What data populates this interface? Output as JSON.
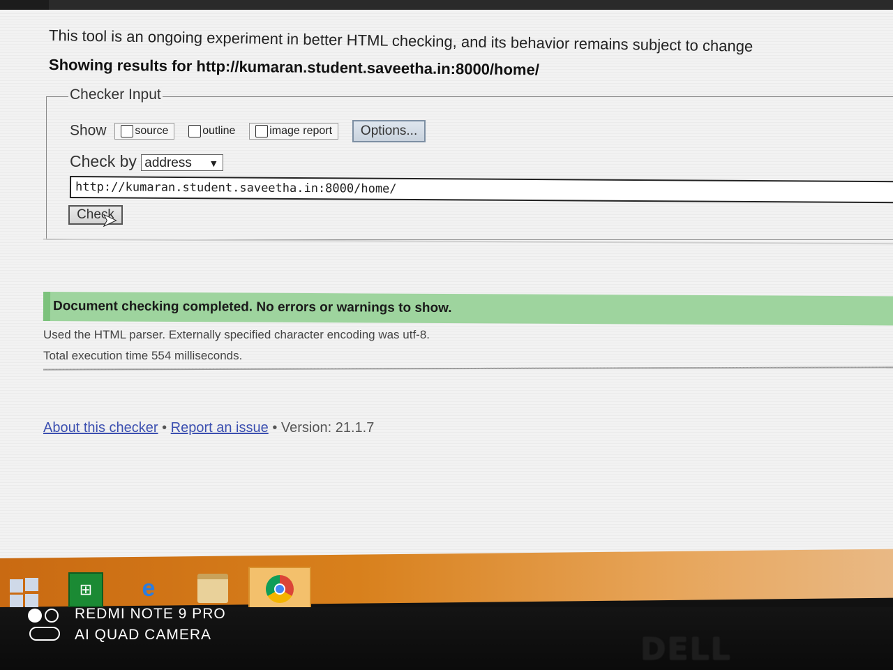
{
  "intro_text": "This tool is an ongoing experiment in better HTML checking, and its behavior remains subject to change",
  "showing_results": "Showing results for http://kumaran.student.saveetha.in:8000/home/",
  "checker_input": {
    "legend": "Checker Input",
    "show_label": "Show",
    "checkboxes": [
      {
        "label": "source",
        "checked": false
      },
      {
        "label": "outline",
        "checked": false
      },
      {
        "label": "image report",
        "checked": false
      }
    ],
    "options_button": "Options...",
    "check_by_label": "Check by",
    "check_by_value": "address",
    "url_value": "http://kumaran.student.saveetha.in:8000/home/",
    "check_button": "Check"
  },
  "result": {
    "success_message": "Document checking completed. No errors or warnings to show.",
    "parser_info": "Used the HTML parser. Externally specified character encoding was utf-8.",
    "execution_time": "Total execution time 554 milliseconds."
  },
  "footer": {
    "about_link": "About this checker",
    "separator": "•",
    "report_link": "Report an issue",
    "version_text": "Version: 21.1.7"
  },
  "taskbar": {
    "icons": [
      "windows-start-icon",
      "store-icon",
      "internet-explorer-icon",
      "file-explorer-icon",
      "chrome-icon"
    ]
  },
  "monitor_logo": "DELL",
  "camera_watermark": {
    "line1": "REDMI NOTE 9 PRO",
    "line2": "AI QUAD CAMERA"
  },
  "colors": {
    "success_bg": "#9ed49e",
    "link": "#3b4fb0",
    "taskbar": "#d8801c"
  }
}
